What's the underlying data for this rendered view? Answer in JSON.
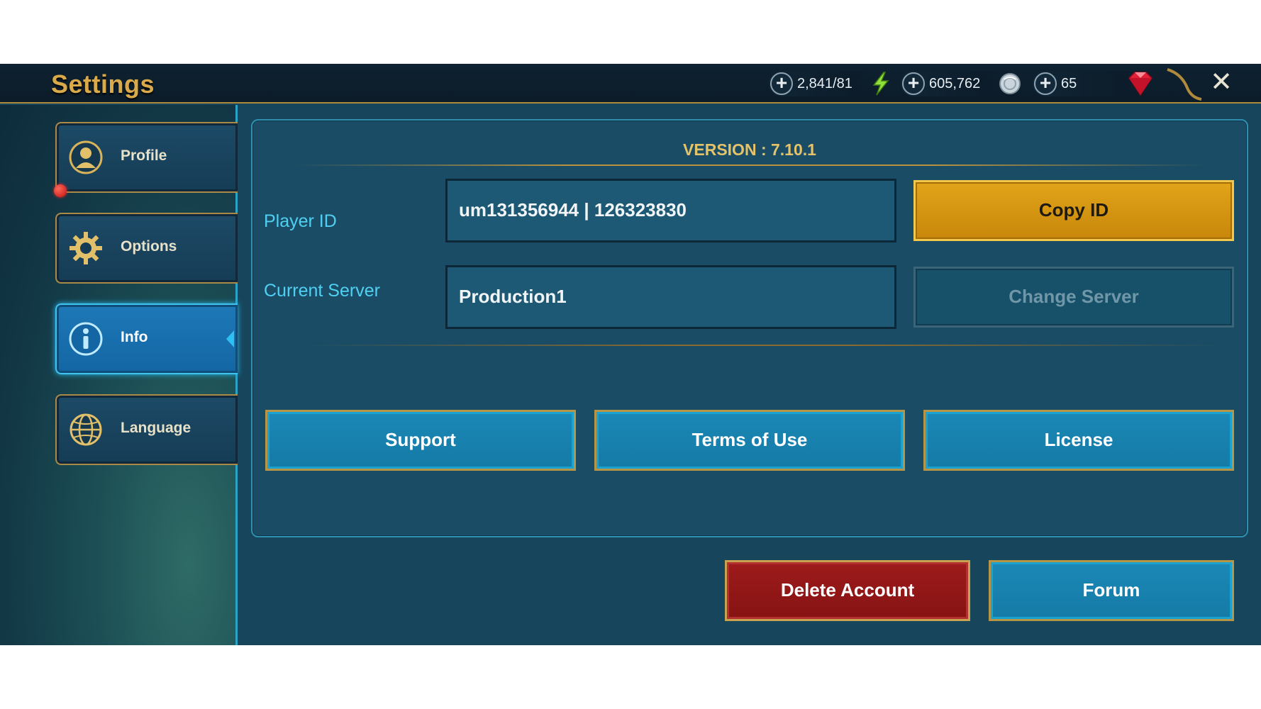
{
  "header": {
    "title": "Settings",
    "resources": [
      {
        "value": "2,841/81",
        "icon": "lightning-bolt-icon"
      },
      {
        "value": "605,762",
        "icon": "silver-coin-icon"
      },
      {
        "value": "65",
        "icon": "red-gem-icon"
      }
    ],
    "close_icon": "close-icon"
  },
  "sidebar": {
    "items": [
      {
        "label": "Profile",
        "icon": "profile-icon",
        "active": false,
        "notification": true
      },
      {
        "label": "Options",
        "icon": "gear-icon",
        "active": false
      },
      {
        "label": "Info",
        "icon": "info-icon",
        "active": true
      },
      {
        "label": "Language",
        "icon": "globe-icon",
        "active": false
      }
    ]
  },
  "info": {
    "version": "VERSION : 7.10.1",
    "player_id_label": "Player ID",
    "player_id_value": "um131356944 | 126323830",
    "copy_id_label": "Copy ID",
    "server_label": "Current Server",
    "server_value": "Production1",
    "change_server_label": "Change Server",
    "support_label": "Support",
    "terms_label": "Terms of Use",
    "license_label": "License"
  },
  "footer": {
    "delete_label": "Delete Account",
    "forum_label": "Forum"
  },
  "colors": {
    "accent_gold": "#d9a94a",
    "active_tab": "#1e78b7",
    "cyan_text": "#4fd0f2",
    "danger": "#9e1b1b"
  }
}
